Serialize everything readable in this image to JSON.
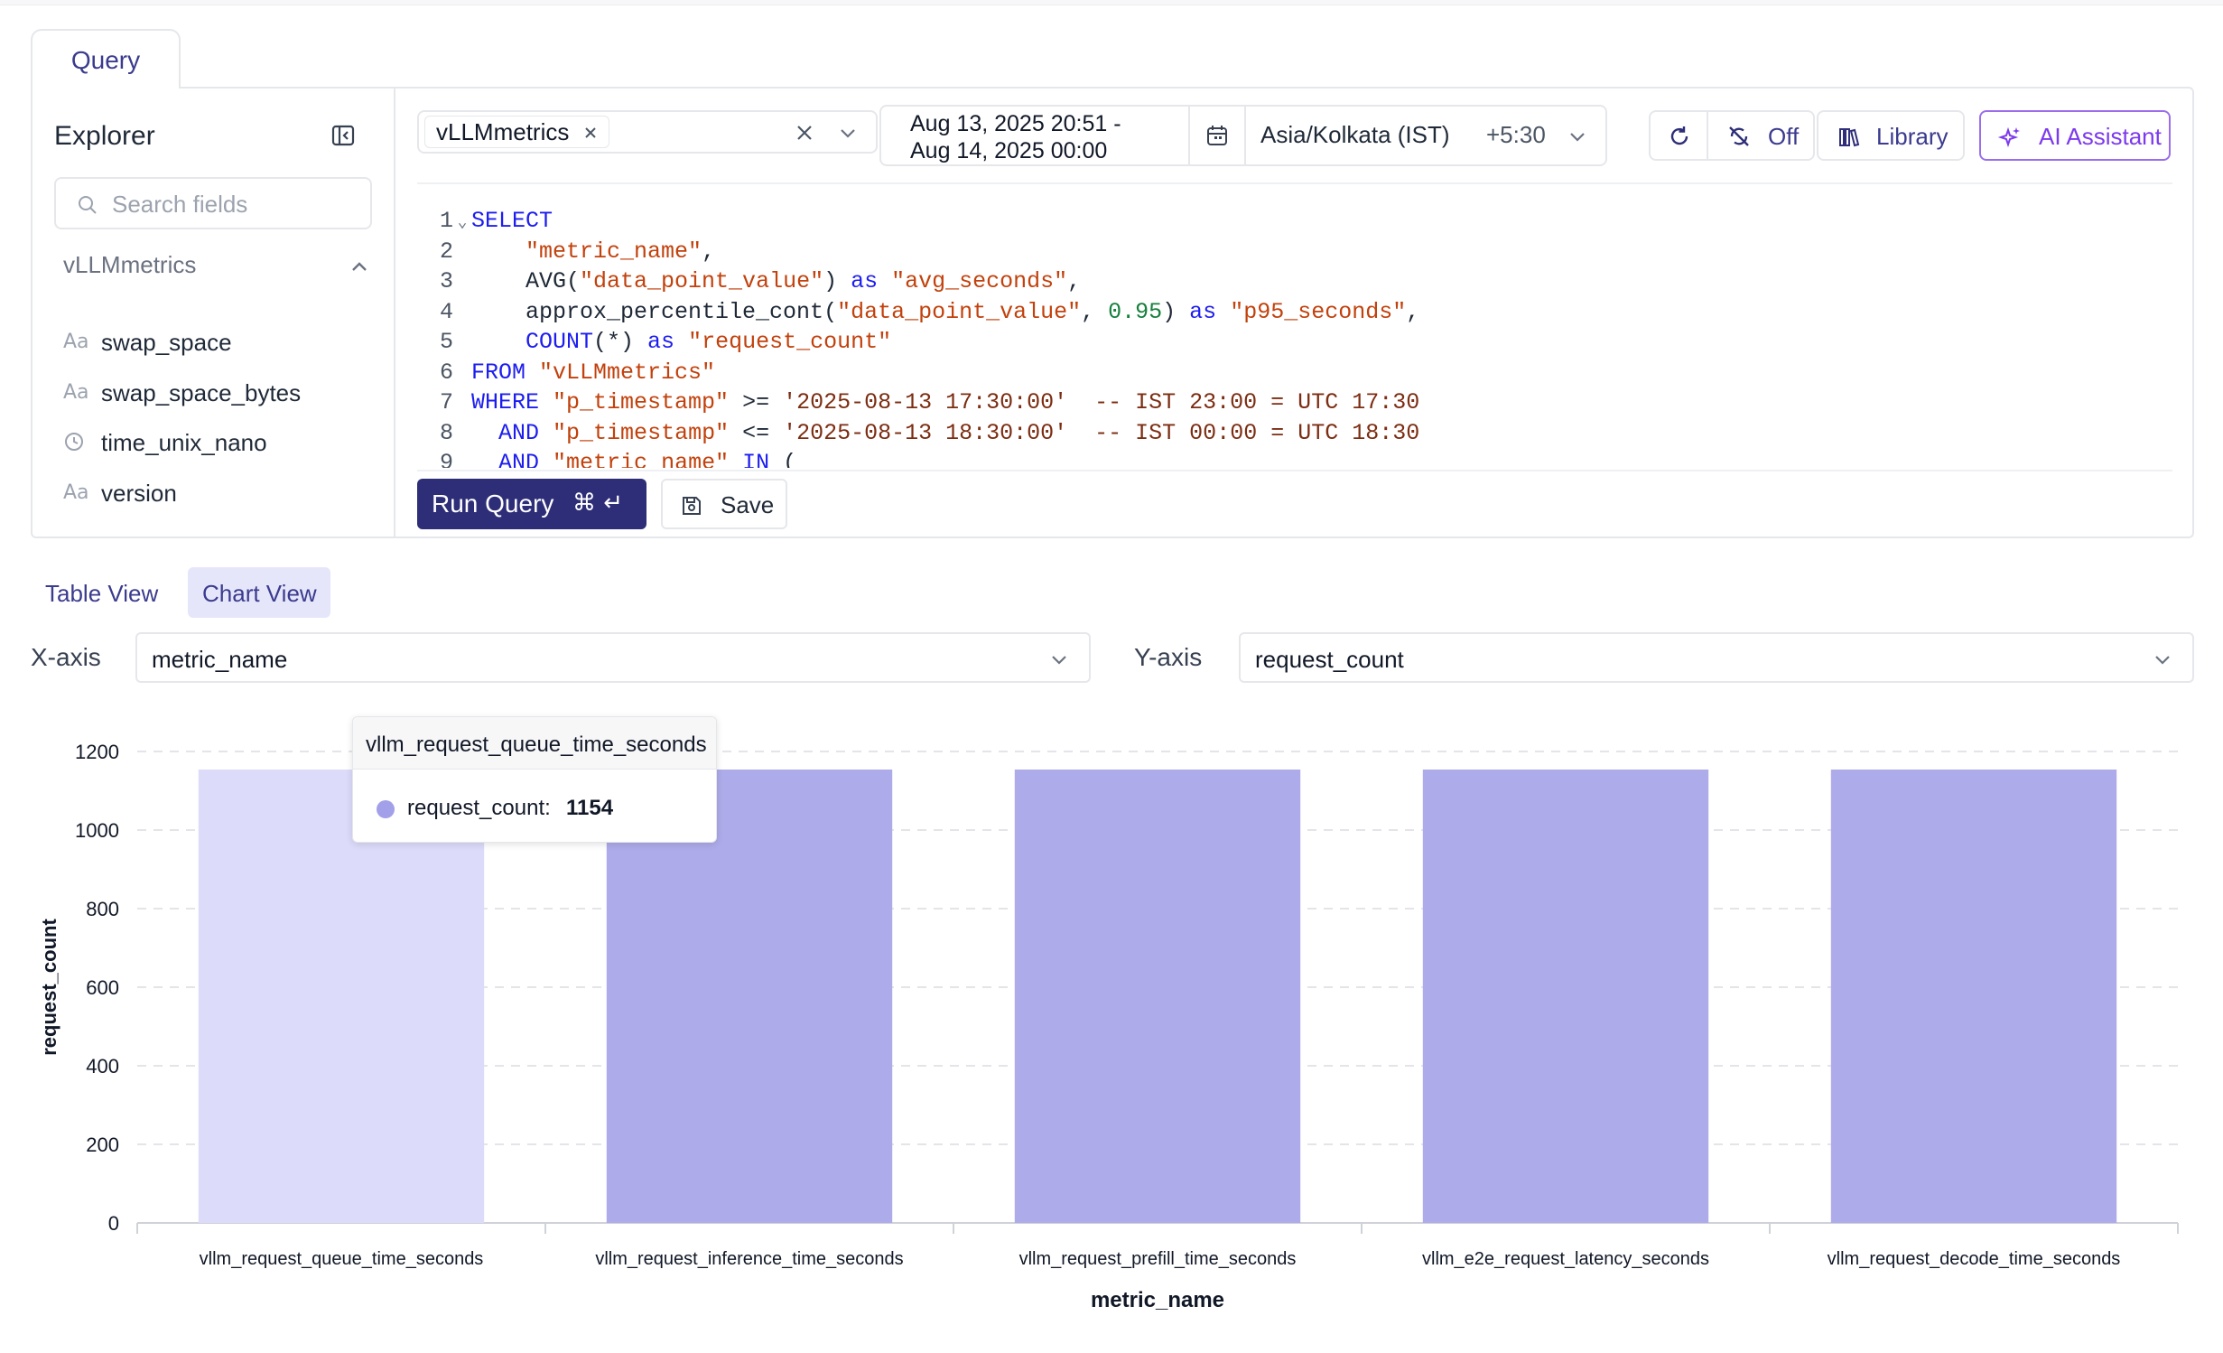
{
  "tabs": {
    "query": "Query"
  },
  "explorer": {
    "title": "Explorer",
    "search_placeholder": "Search fields",
    "group": "vLLMmetrics",
    "fields": [
      {
        "icon": "text-type-icon",
        "name": "swap_space"
      },
      {
        "icon": "text-type-icon",
        "name": "swap_space_bytes"
      },
      {
        "icon": "clock-icon",
        "name": "time_unix_nano"
      },
      {
        "icon": "text-type-icon",
        "name": "version"
      }
    ]
  },
  "toolbar": {
    "stream_chip": "vLLMmetrics",
    "date_range_line1": "Aug 13, 2025 20:51 -",
    "date_range_line2": "Aug 14, 2025 00:00",
    "timezone": "Asia/Kolkata (IST)",
    "tz_offset": "+5:30",
    "refresh_off": "Off",
    "library": "Library",
    "ai_assistant": "AI Assistant"
  },
  "editor": {
    "lines": [
      {
        "n": "1",
        "fold": true,
        "tokens": [
          [
            "kw",
            "SELECT"
          ]
        ]
      },
      {
        "n": "2",
        "tokens": [
          [
            "code",
            "    "
          ],
          [
            "str",
            "\"metric_name\""
          ],
          [
            "code",
            ","
          ]
        ]
      },
      {
        "n": "3",
        "tokens": [
          [
            "code",
            "    AVG("
          ],
          [
            "str",
            "\"data_point_value\""
          ],
          [
            "code",
            ") "
          ],
          [
            "kw",
            "as"
          ],
          [
            "code",
            " "
          ],
          [
            "str",
            "\"avg_seconds\""
          ],
          [
            "code",
            ","
          ]
        ]
      },
      {
        "n": "4",
        "tokens": [
          [
            "code",
            "    approx_percentile_cont("
          ],
          [
            "str",
            "\"data_point_value\""
          ],
          [
            "code",
            ", "
          ],
          [
            "num",
            "0.95"
          ],
          [
            "code",
            ") "
          ],
          [
            "kw",
            "as"
          ],
          [
            "code",
            " "
          ],
          [
            "str",
            "\"p95_seconds\""
          ],
          [
            "code",
            ","
          ]
        ]
      },
      {
        "n": "5",
        "tokens": [
          [
            "code",
            "    "
          ],
          [
            "kw",
            "COUNT"
          ],
          [
            "code",
            "(*) "
          ],
          [
            "kw",
            "as"
          ],
          [
            "code",
            " "
          ],
          [
            "str",
            "\"request_count\""
          ]
        ]
      },
      {
        "n": "6",
        "tokens": [
          [
            "kw",
            "FROM"
          ],
          [
            "code",
            " "
          ],
          [
            "str",
            "\"vLLMmetrics\""
          ]
        ]
      },
      {
        "n": "7",
        "tokens": [
          [
            "kw",
            "WHERE"
          ],
          [
            "code",
            " "
          ],
          [
            "str",
            "\"p_timestamp\""
          ],
          [
            "code",
            " >= "
          ],
          [
            "cm",
            "'2025-08-13 17:30:00'  -- IST 23:00 = UTC 17:30"
          ]
        ]
      },
      {
        "n": "8",
        "tokens": [
          [
            "code",
            "  "
          ],
          [
            "kw",
            "AND"
          ],
          [
            "code",
            " "
          ],
          [
            "str",
            "\"p_timestamp\""
          ],
          [
            "code",
            " <= "
          ],
          [
            "cm",
            "'2025-08-13 18:30:00'  -- IST 00:00 = UTC 18:30"
          ]
        ]
      },
      {
        "n": "9",
        "tokens": [
          [
            "code",
            "  "
          ],
          [
            "kw",
            "AND"
          ],
          [
            "code",
            " "
          ],
          [
            "str",
            "\"metric_name\""
          ],
          [
            "code",
            " "
          ],
          [
            "kw",
            "IN"
          ],
          [
            "code",
            " ("
          ]
        ]
      }
    ]
  },
  "actions": {
    "run": "Run Query",
    "run_shortcut": "⌘ ↵",
    "save": "Save"
  },
  "views": {
    "table": "Table View",
    "chart": "Chart View",
    "active": "chart"
  },
  "axes": {
    "x_label": "X-axis",
    "x_value": "metric_name",
    "y_label": "Y-axis",
    "y_value": "request_count"
  },
  "tooltip": {
    "title": "vllm_request_queue_time_seconds",
    "series_label": "request_count:",
    "value": "1154"
  },
  "colors": {
    "bar": "#aeabea",
    "bar_highlight": "#dcdbfa",
    "accent": "#2e2e78"
  },
  "chart_data": {
    "type": "bar",
    "categories": [
      "vllm_request_queue_time_seconds",
      "vllm_request_inference_time_seconds",
      "vllm_request_prefill_time_seconds",
      "vllm_e2e_request_latency_seconds",
      "vllm_request_decode_time_seconds"
    ],
    "series": [
      {
        "name": "request_count",
        "values": [
          1154,
          1154,
          1154,
          1154,
          1154
        ]
      }
    ],
    "xlabel": "metric_name",
    "ylabel": "request_count",
    "ylim": [
      0,
      1200
    ],
    "yticks": [
      0,
      200,
      400,
      600,
      800,
      1000,
      1200
    ],
    "grid": true,
    "highlighted_category": "vllm_request_queue_time_seconds"
  }
}
